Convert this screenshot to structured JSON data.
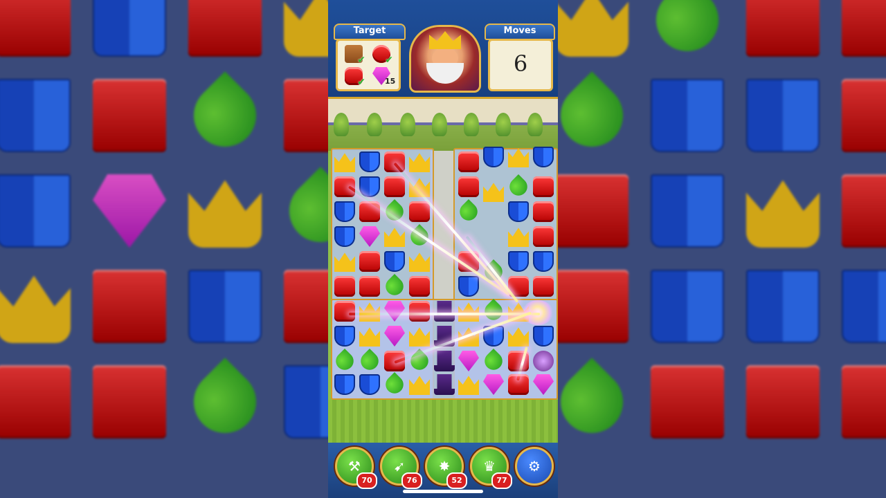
{
  "header": {
    "target_label": "Target",
    "moves_label": "Moves",
    "moves_value": "6",
    "targets": [
      {
        "icon": "brown-box-icon",
        "completed": true,
        "count": ""
      },
      {
        "icon": "red-parrot-icon",
        "completed": true,
        "count": ""
      },
      {
        "icon": "red-drum-icon",
        "completed": true,
        "count": ""
      },
      {
        "icon": "purple-gem-icon",
        "completed": false,
        "count": "15"
      }
    ]
  },
  "boosters": [
    {
      "icon": "hammer-icon",
      "count": "70"
    },
    {
      "icon": "arrow-icon",
      "count": "76"
    },
    {
      "icon": "cannon-icon",
      "count": "52"
    },
    {
      "icon": "jester-hat-icon",
      "count": "77"
    },
    {
      "icon": "gear-icon",
      "count": ""
    }
  ],
  "colors": {
    "topbar": "#1f4f9a",
    "frame_gold": "#e6b84a",
    "badge_red": "#d92020",
    "booster_green": "#2a8a1a"
  }
}
